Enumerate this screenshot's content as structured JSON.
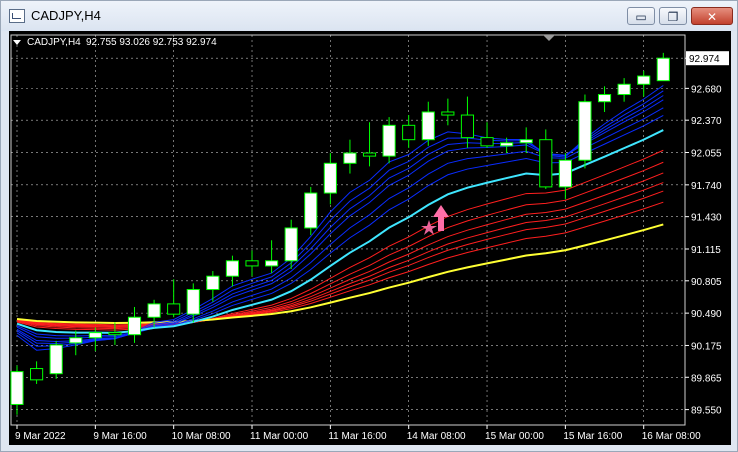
{
  "window": {
    "title": "CADJPY,H4",
    "buttons": {
      "minimize": "▭",
      "restore": "❐",
      "close": "✕"
    }
  },
  "chart_info": {
    "symbol_label": "CADJPY,H4",
    "ohlc": "92.755 93.026 92.753 92.974",
    "current_price": "92.974"
  },
  "colors": {
    "background": "#000000",
    "grid": "#ffffff",
    "bull_candle": "#ffffff",
    "bear_candle": "#000000",
    "candle_outline": "#00ff00",
    "fast_ribbon": "#0a2cff",
    "slow_ribbon": "#ff1f1f",
    "cyan_ma": "#3fe6ff",
    "yellow_ma": "#ffff33",
    "arrow": "#ff6ea8"
  },
  "chart_data": {
    "type": "candlestick",
    "timeframe": "H4",
    "ylim": [
      89.4,
      93.2
    ],
    "y_ticks": [
      "92.974",
      "92.680",
      "92.370",
      "92.055",
      "91.740",
      "91.430",
      "91.115",
      "90.805",
      "90.490",
      "90.175",
      "89.865",
      "89.550"
    ],
    "x_ticks": [
      "9 Mar 2022",
      "9 Mar 16:00",
      "10 Mar 08:00",
      "11 Mar 00:00",
      "11 Mar 16:00",
      "14 Mar 08:00",
      "15 Mar 00:00",
      "15 Mar 16:00",
      "16 Mar 08:00"
    ],
    "candles": [
      {
        "o": 89.6,
        "h": 89.98,
        "l": 89.5,
        "c": 89.92
      },
      {
        "o": 89.95,
        "h": 90.02,
        "l": 89.8,
        "c": 89.84
      },
      {
        "o": 89.9,
        "h": 90.22,
        "l": 89.85,
        "c": 90.18
      },
      {
        "o": 90.2,
        "h": 90.32,
        "l": 90.08,
        "c": 90.25
      },
      {
        "o": 90.25,
        "h": 90.35,
        "l": 90.12,
        "c": 90.3
      },
      {
        "o": 90.3,
        "h": 90.4,
        "l": 90.18,
        "c": 90.28
      },
      {
        "o": 90.28,
        "h": 90.55,
        "l": 90.2,
        "c": 90.45
      },
      {
        "o": 90.45,
        "h": 90.62,
        "l": 90.35,
        "c": 90.58
      },
      {
        "o": 90.58,
        "h": 90.82,
        "l": 90.45,
        "c": 90.48
      },
      {
        "o": 90.48,
        "h": 90.78,
        "l": 90.4,
        "c": 90.72
      },
      {
        "o": 90.72,
        "h": 90.9,
        "l": 90.6,
        "c": 90.85
      },
      {
        "o": 90.85,
        "h": 91.05,
        "l": 90.75,
        "c": 91.0
      },
      {
        "o": 91.0,
        "h": 91.1,
        "l": 90.85,
        "c": 90.95
      },
      {
        "o": 90.95,
        "h": 91.2,
        "l": 90.88,
        "c": 91.0
      },
      {
        "o": 91.0,
        "h": 91.4,
        "l": 90.92,
        "c": 91.32
      },
      {
        "o": 91.32,
        "h": 91.72,
        "l": 91.25,
        "c": 91.66
      },
      {
        "o": 91.66,
        "h": 92.05,
        "l": 91.55,
        "c": 91.95
      },
      {
        "o": 91.95,
        "h": 92.18,
        "l": 91.85,
        "c": 92.05
      },
      {
        "o": 92.05,
        "h": 92.35,
        "l": 91.92,
        "c": 92.02
      },
      {
        "o": 92.02,
        "h": 92.4,
        "l": 91.95,
        "c": 92.32
      },
      {
        "o": 92.32,
        "h": 92.42,
        "l": 92.1,
        "c": 92.18
      },
      {
        "o": 92.18,
        "h": 92.55,
        "l": 92.12,
        "c": 92.45
      },
      {
        "o": 92.45,
        "h": 92.58,
        "l": 92.32,
        "c": 92.42
      },
      {
        "o": 92.42,
        "h": 92.6,
        "l": 92.1,
        "c": 92.2
      },
      {
        "o": 92.2,
        "h": 92.35,
        "l": 92.1,
        "c": 92.12
      },
      {
        "o": 92.12,
        "h": 92.2,
        "l": 92.05,
        "c": 92.15
      },
      {
        "o": 92.15,
        "h": 92.3,
        "l": 92.05,
        "c": 92.18
      },
      {
        "o": 92.18,
        "h": 92.28,
        "l": 91.7,
        "c": 91.72
      },
      {
        "o": 91.72,
        "h": 92.05,
        "l": 91.6,
        "c": 91.98
      },
      {
        "o": 91.98,
        "h": 92.62,
        "l": 91.9,
        "c": 92.55
      },
      {
        "o": 92.55,
        "h": 92.7,
        "l": 92.45,
        "c": 92.62
      },
      {
        "o": 92.62,
        "h": 92.78,
        "l": 92.55,
        "c": 92.72
      },
      {
        "o": 92.72,
        "h": 92.85,
        "l": 92.6,
        "c": 92.8
      },
      {
        "o": 92.755,
        "h": 93.026,
        "l": 92.753,
        "c": 92.974
      }
    ]
  }
}
